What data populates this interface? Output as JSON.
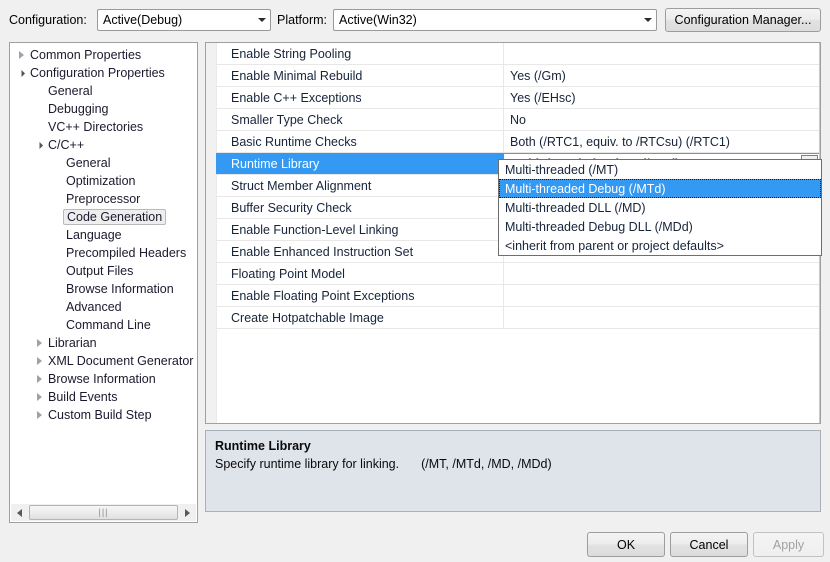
{
  "header": {
    "configuration_label": "Configuration:",
    "configuration_value": "Active(Debug)",
    "platform_label": "Platform:",
    "platform_value": "Active(Win32)",
    "configuration_manager_button": "Configuration Manager..."
  },
  "tree": {
    "items": [
      {
        "label": "Common Properties",
        "level": 0,
        "expander": "collapsed",
        "selected": false
      },
      {
        "label": "Configuration Properties",
        "level": 0,
        "expander": "expanded",
        "selected": false
      },
      {
        "label": "General",
        "level": 1,
        "expander": "none",
        "selected": false
      },
      {
        "label": "Debugging",
        "level": 1,
        "expander": "none",
        "selected": false
      },
      {
        "label": "VC++ Directories",
        "level": 1,
        "expander": "none",
        "selected": false
      },
      {
        "label": "C/C++",
        "level": 1,
        "expander": "expanded",
        "selected": false
      },
      {
        "label": "General",
        "level": 2,
        "expander": "none",
        "selected": false
      },
      {
        "label": "Optimization",
        "level": 2,
        "expander": "none",
        "selected": false
      },
      {
        "label": "Preprocessor",
        "level": 2,
        "expander": "none",
        "selected": false
      },
      {
        "label": "Code Generation",
        "level": 2,
        "expander": "none",
        "selected": true
      },
      {
        "label": "Language",
        "level": 2,
        "expander": "none",
        "selected": false
      },
      {
        "label": "Precompiled Headers",
        "level": 2,
        "expander": "none",
        "selected": false
      },
      {
        "label": "Output Files",
        "level": 2,
        "expander": "none",
        "selected": false
      },
      {
        "label": "Browse Information",
        "level": 2,
        "expander": "none",
        "selected": false
      },
      {
        "label": "Advanced",
        "level": 2,
        "expander": "none",
        "selected": false
      },
      {
        "label": "Command Line",
        "level": 2,
        "expander": "none",
        "selected": false
      },
      {
        "label": "Librarian",
        "level": 1,
        "expander": "collapsed",
        "selected": false
      },
      {
        "label": "XML Document Generator",
        "level": 1,
        "expander": "collapsed",
        "selected": false
      },
      {
        "label": "Browse Information",
        "level": 1,
        "expander": "collapsed",
        "selected": false
      },
      {
        "label": "Build Events",
        "level": 1,
        "expander": "collapsed",
        "selected": false
      },
      {
        "label": "Custom Build Step",
        "level": 1,
        "expander": "collapsed",
        "selected": false
      }
    ]
  },
  "grid": {
    "rows": [
      {
        "name": "Enable String Pooling",
        "value": "",
        "selected": false,
        "editing": false
      },
      {
        "name": "Enable Minimal Rebuild",
        "value": "Yes (/Gm)",
        "selected": false,
        "editing": false
      },
      {
        "name": "Enable C++ Exceptions",
        "value": "Yes (/EHsc)",
        "selected": false,
        "editing": false
      },
      {
        "name": "Smaller Type Check",
        "value": "No",
        "selected": false,
        "editing": false
      },
      {
        "name": "Basic Runtime Checks",
        "value": "Both (/RTC1, equiv. to /RTCsu) (/RTC1)",
        "selected": false,
        "editing": false
      },
      {
        "name": "Runtime Library",
        "value": "Multi-threaded Debug (/MTd)",
        "selected": true,
        "editing": true
      },
      {
        "name": "Struct Member Alignment",
        "value": "",
        "selected": false,
        "editing": false
      },
      {
        "name": "Buffer Security Check",
        "value": "",
        "selected": false,
        "editing": false
      },
      {
        "name": "Enable Function-Level Linking",
        "value": "",
        "selected": false,
        "editing": false
      },
      {
        "name": "Enable Enhanced Instruction Set",
        "value": "",
        "selected": false,
        "editing": false
      },
      {
        "name": "Floating Point Model",
        "value": "",
        "selected": false,
        "editing": false
      },
      {
        "name": "Enable Floating Point Exceptions",
        "value": "",
        "selected": false,
        "editing": false
      },
      {
        "name": "Create Hotpatchable Image",
        "value": "",
        "selected": false,
        "editing": false
      }
    ]
  },
  "dropdown": {
    "open": true,
    "options": [
      {
        "label": "Multi-threaded (/MT)",
        "highlight": false
      },
      {
        "label": "Multi-threaded Debug (/MTd)",
        "highlight": true
      },
      {
        "label": "Multi-threaded DLL (/MD)",
        "highlight": false
      },
      {
        "label": "Multi-threaded Debug DLL (/MDd)",
        "highlight": false
      },
      {
        "label": "<inherit from parent or project defaults>",
        "highlight": false
      }
    ]
  },
  "description": {
    "title": "Runtime Library",
    "text": "Specify runtime library for linking.",
    "switches": "(/MT, /MTd, /MD, /MDd)"
  },
  "footer": {
    "ok_label": "OK",
    "cancel_label": "Cancel",
    "apply_label": "Apply"
  },
  "colors": {
    "selection_blue": "#3399f3",
    "dialog_bg": "#f0f0f0",
    "description_bg": "#dfe3ea"
  }
}
